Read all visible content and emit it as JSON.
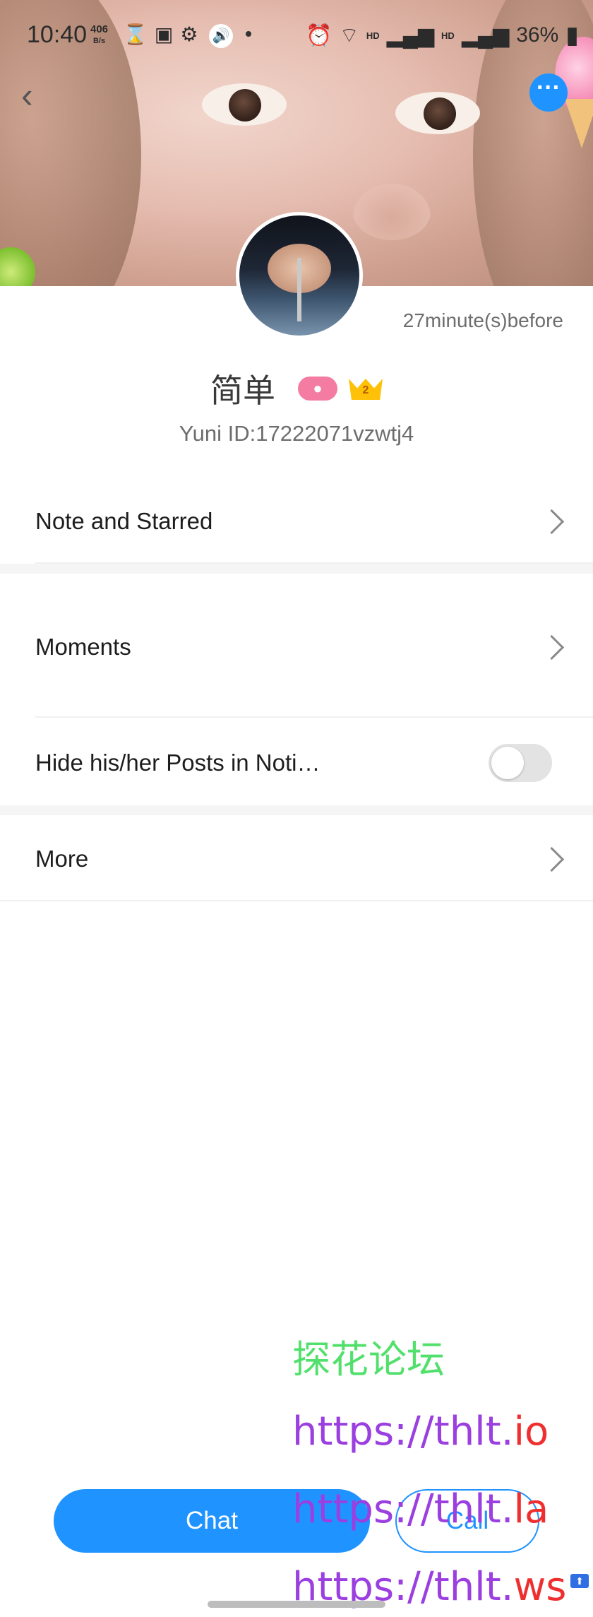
{
  "status_bar": {
    "time": "10:40",
    "net_speed_value": "406",
    "net_speed_unit": "B/s",
    "battery": "36%",
    "hd1": "HD",
    "hd2": "HD"
  },
  "profile": {
    "last_active": "27minute(s)before",
    "name": "简单",
    "crown_level": "2",
    "yuni_id": "Yuni ID:17222071vzwtj4"
  },
  "menu": {
    "note_starred": "Note and Starred",
    "moments": "Moments",
    "hide_posts": "Hide his/her Posts in Noti…",
    "hide_posts_enabled": false,
    "more": "More"
  },
  "actions": {
    "chat": "Chat",
    "call": "Call"
  },
  "watermark": {
    "title": "探花论坛",
    "urls": [
      {
        "a": "https://thlt.",
        "b": "io"
      },
      {
        "a": "https://thlt.",
        "b": "la"
      },
      {
        "a": "https://thlt.",
        "b": "ws"
      }
    ]
  },
  "colors": {
    "accent": "#1f93ff",
    "gender_badge": "#f47ba1",
    "crown": "#ffc107"
  },
  "icons": {
    "back": "chevron-left-icon",
    "more": "more-dots-icon",
    "chevron": "chevron-right-icon"
  }
}
